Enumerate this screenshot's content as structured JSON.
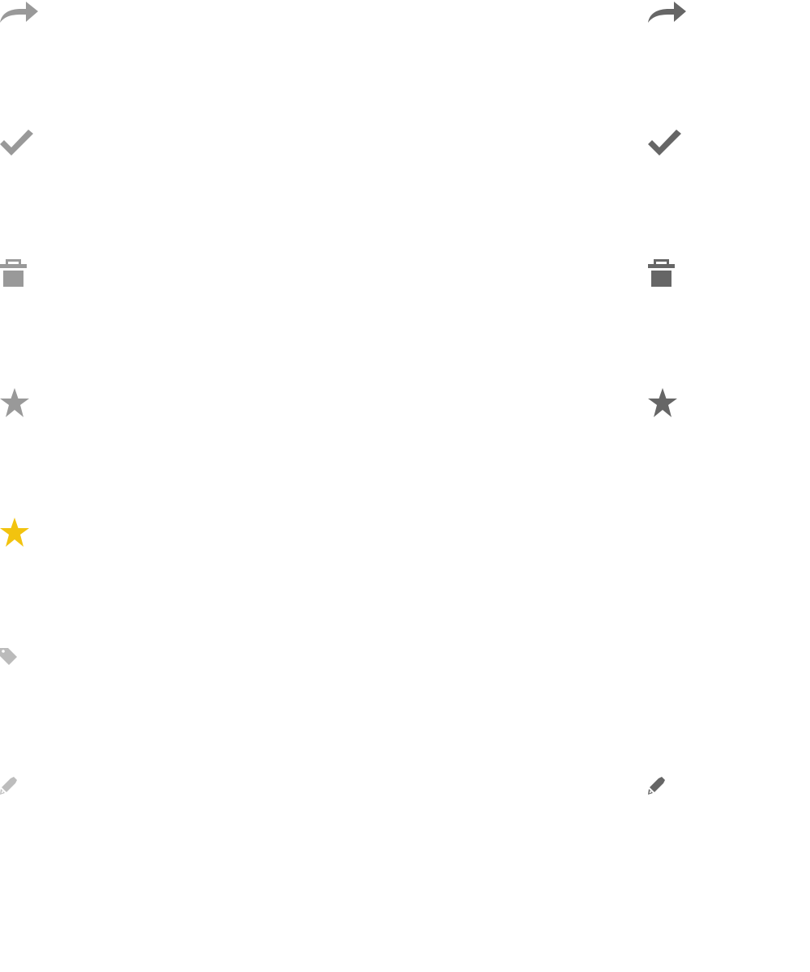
{
  "colors": {
    "normal": "#999999",
    "hover": "#666666",
    "label": "#bbbbbb",
    "edit_normal": "#bdbdbd",
    "starred": "#f2c30f",
    "background": "#ffffff"
  },
  "icons": [
    {
      "row": "forward",
      "icon": "forward-arrow-icon",
      "variants": [
        "normal",
        "hover"
      ]
    },
    {
      "row": "check",
      "icon": "checkmark-icon",
      "variants": [
        "normal",
        "hover"
      ]
    },
    {
      "row": "trash",
      "icon": "trash-icon",
      "variants": [
        "normal",
        "hover"
      ]
    },
    {
      "row": "star",
      "icon": "star-icon",
      "variants": [
        "normal",
        "hover"
      ]
    },
    {
      "row": "star-active",
      "icon": "star-filled-icon",
      "variants": [
        "starred"
      ]
    },
    {
      "row": "label",
      "icon": "tag-icon",
      "variants": [
        "normal"
      ]
    },
    {
      "row": "edit",
      "icon": "pencil-icon",
      "variants": [
        "normal",
        "hover"
      ]
    }
  ]
}
